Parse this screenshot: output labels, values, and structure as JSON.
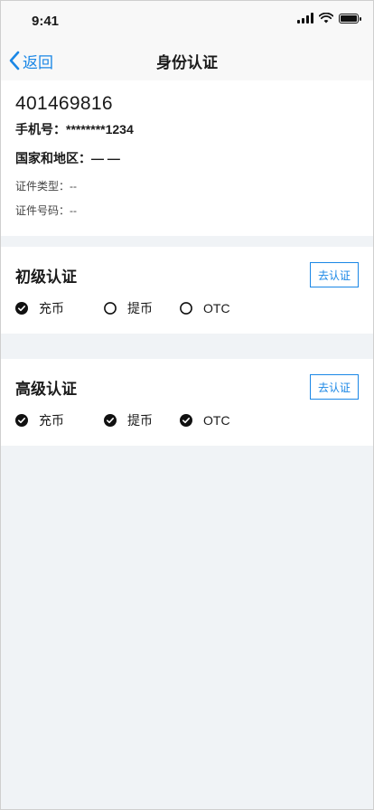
{
  "status_bar": {
    "time": "9:41"
  },
  "nav": {
    "back_label": "返回",
    "title": "身份认证"
  },
  "profile": {
    "uid": "401469816",
    "phone": "手机号：********1234",
    "region": "国家和地区：— —",
    "id_type": "证件类型：--",
    "id_number": "证件号码：--"
  },
  "levels": [
    {
      "title": "初级认证",
      "button": "去认证",
      "perms": [
        {
          "label": "充币",
          "checked": true
        },
        {
          "label": "提币",
          "checked": false
        },
        {
          "label": "OTC",
          "checked": false
        }
      ]
    },
    {
      "title": "高级认证",
      "button": "去认证",
      "perms": [
        {
          "label": "充币",
          "checked": true
        },
        {
          "label": "提币",
          "checked": true
        },
        {
          "label": "OTC",
          "checked": true
        }
      ]
    }
  ],
  "colors": {
    "accent": "#1a87e6",
    "page_bg": "#f0f3f6"
  }
}
